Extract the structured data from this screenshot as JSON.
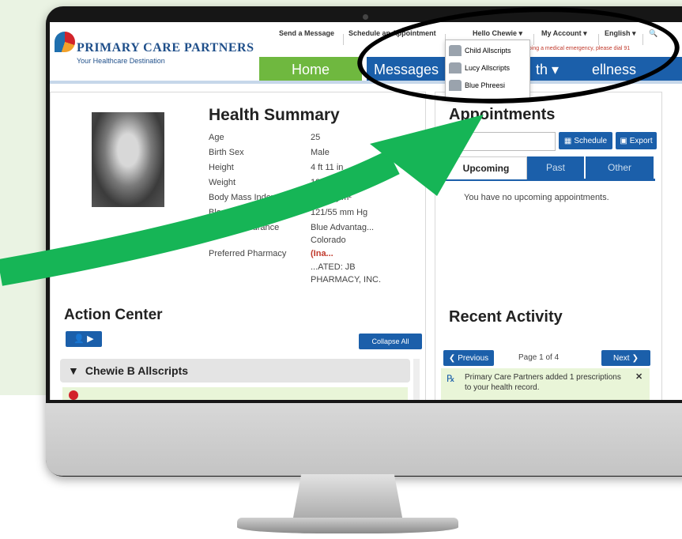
{
  "brand": {
    "name": "PRIMARY CARE PARTNERS",
    "tagline": "Your Healthcare Destination"
  },
  "header": {
    "send_message": "Send a Message",
    "schedule_appointment": "Schedule an Appointment",
    "hello_user": "Hello Chewie",
    "my_account": "My Account",
    "language": "English",
    "emergency": "hoing a medical emergency, please dial 91"
  },
  "nav": {
    "home": "Home",
    "messages": "Messages",
    "health": "th",
    "wellness": "ellness"
  },
  "account_menu": [
    "Child Allscripts",
    "Lucy Allscripts",
    "Blue Phreesi"
  ],
  "health_summary": {
    "title": "Health Summary",
    "rows": [
      {
        "label": "Age",
        "value": "25"
      },
      {
        "label": "Birth Sex",
        "value": "Male"
      },
      {
        "label": "Height",
        "value": "4 ft 11 in"
      },
      {
        "label": "Weight",
        "value": "184.0 lb"
      },
      {
        "label": "Body Mass Index",
        "value": "36.2 kg/m²"
      },
      {
        "label": "Blood Pressure",
        "value": "121/55 mm Hg"
      },
      {
        "label": "Primary Insurance",
        "value": "Blue Advantag..."
      },
      {
        "label": "",
        "value": "Colorado"
      },
      {
        "label": "Preferred Pharmacy",
        "value": "(Ina..."
      },
      {
        "label": "",
        "value": "...ATED: JB"
      },
      {
        "label": "",
        "value": "PHARMACY, INC."
      }
    ]
  },
  "action_center": {
    "title": "Action Center",
    "collapse": "Collapse All",
    "group": "Chewie B Allscripts"
  },
  "appointments": {
    "title": "Appointments",
    "schedule": "Schedule",
    "export": "Export",
    "tabs": [
      "Upcoming",
      "Past",
      "Other"
    ],
    "empty": "You have no upcoming appointments."
  },
  "recent_activity": {
    "title": "Recent Activity",
    "previous": "Previous",
    "page": "Page 1 of 4",
    "next": "Next",
    "item": "Primary Care Partners added 1 prescriptions to your health record."
  },
  "colors": {
    "brand_blue": "#1b5faa",
    "home_green": "#6fb83f",
    "arrow_green": "#16b556",
    "highlight": "#000000"
  }
}
